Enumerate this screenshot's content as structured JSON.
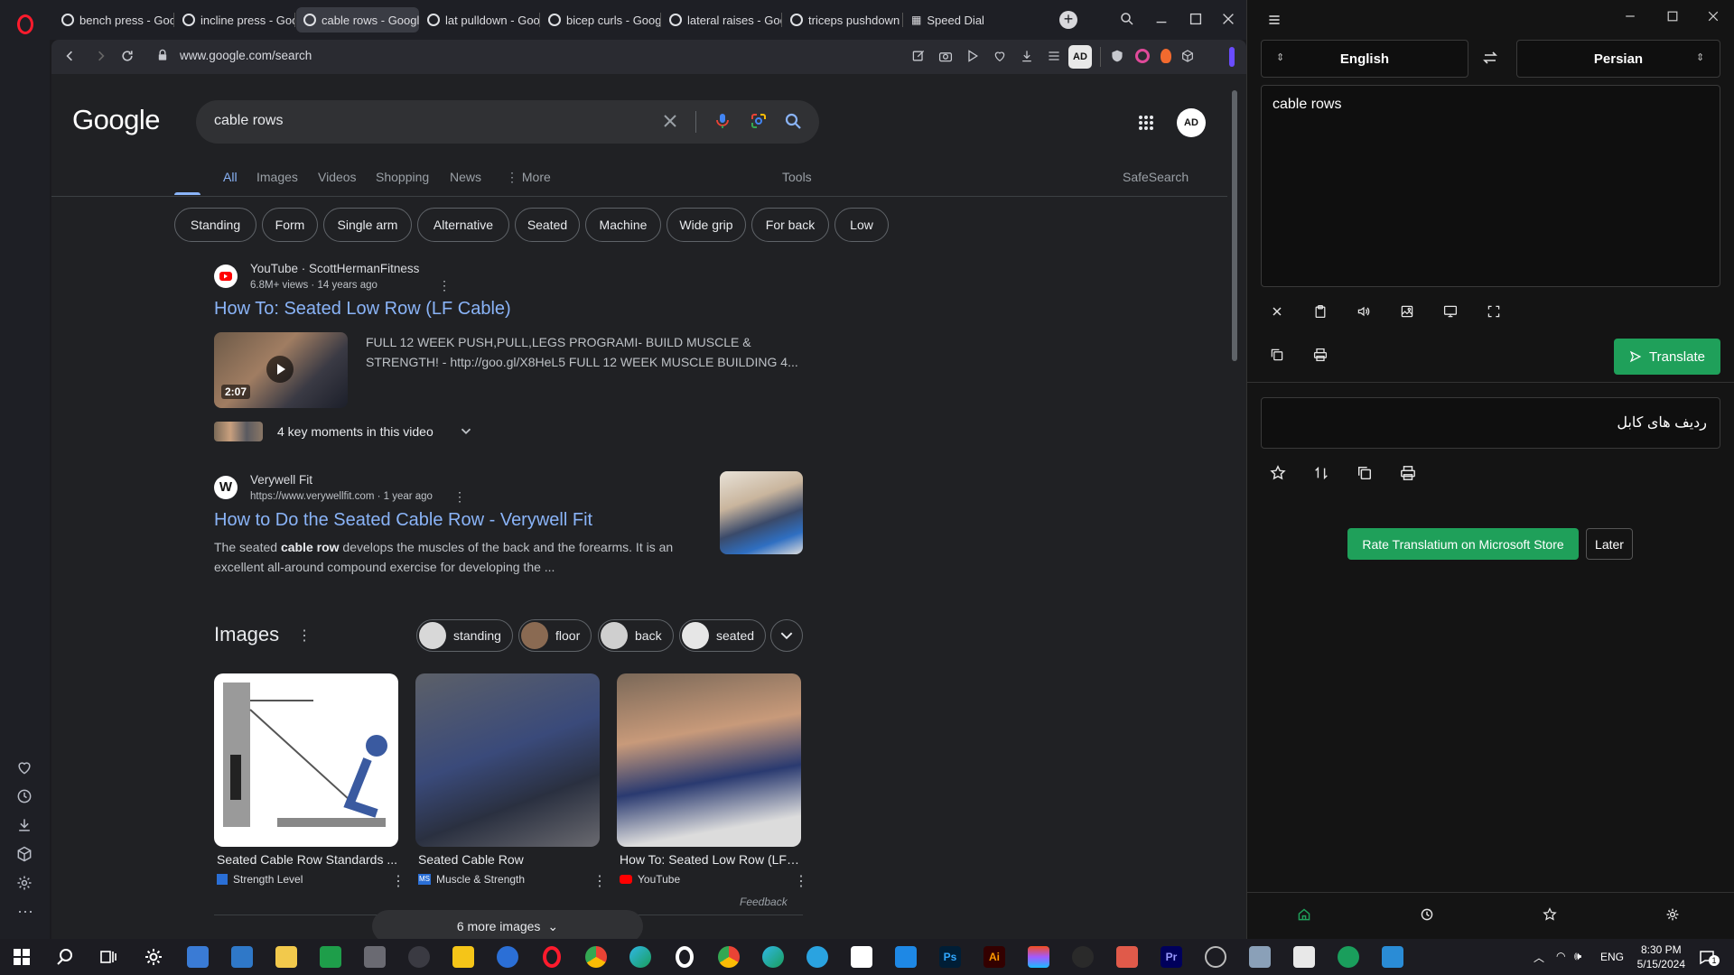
{
  "browser": {
    "tabs": [
      {
        "label": "bench press - Goog"
      },
      {
        "label": "incline press - Goog"
      },
      {
        "label": "cable rows - Google Search",
        "active": true
      },
      {
        "label": "lat pulldown - Goog"
      },
      {
        "label": "bicep curls - Google"
      },
      {
        "label": "lateral raises - Goog"
      },
      {
        "label": "triceps pushdown -"
      },
      {
        "label": "Speed Dial"
      }
    ],
    "url": "www.google.com/search"
  },
  "google": {
    "logo": "Google",
    "query": "cable rows",
    "nav": {
      "all": "All",
      "images": "Images",
      "videos": "Videos",
      "shopping": "Shopping",
      "news": "News",
      "more": "More",
      "tools": "Tools",
      "safesearch": "SafeSearch"
    },
    "chips": [
      "Standing",
      "Form",
      "Single arm",
      "Alternative",
      "Seated",
      "Machine",
      "Wide grip",
      "For back",
      "Low"
    ],
    "result1": {
      "source": "YouTube · ScottHermanFitness",
      "meta": "6.8M+ views · 14 years ago",
      "title": "How To: Seated Low Row (LF Cable)",
      "snippet": "FULL 12 WEEK PUSH,PULL,LEGS PROGRAMI- BUILD MUSCLE & STRENGTH! - http://goo.gl/X8HeL5 FULL 12 WEEK MUSCLE BUILDING 4...",
      "duration": "2:07",
      "key_moments": "4 key moments in this video"
    },
    "result2": {
      "source": "Verywell Fit",
      "meta": "https://www.verywellfit.com · 1 year ago",
      "title": "How to Do the Seated Cable Row - Verywell Fit",
      "snippet_pre": "The seated ",
      "snippet_bold": "cable row",
      "snippet_post": " develops the muscles of the back and the forearms. It is an excellent all-around compound exercise for developing the ..."
    },
    "images": {
      "heading": "Images",
      "chips": [
        "standing",
        "floor",
        "back",
        "seated"
      ],
      "cards": [
        {
          "title": "Seated Cable Row Standards ...",
          "source": "Strength Level"
        },
        {
          "title": "Seated Cable Row",
          "source": "Muscle & Strength"
        },
        {
          "title": "How To: Seated Low Row (LF ...",
          "source": "YouTube"
        }
      ],
      "feedback": "Feedback",
      "more": "6 more images"
    }
  },
  "translator": {
    "source_lang": "English",
    "target_lang": "Persian",
    "input_text": "cable rows",
    "output_text": "ردیف های کابل",
    "translate_label": "Translate",
    "rate_label": "Rate Translatium on Microsoft Store",
    "later_label": "Later"
  },
  "taskbar": {
    "lang": "ENG",
    "time": "8:30 PM",
    "date": "5/15/2024",
    "notifications": "1"
  },
  "colors": {
    "accent_link": "#8ab4f8",
    "translate_green": "#1fa05a",
    "opera_red": "#ff1b2d"
  }
}
